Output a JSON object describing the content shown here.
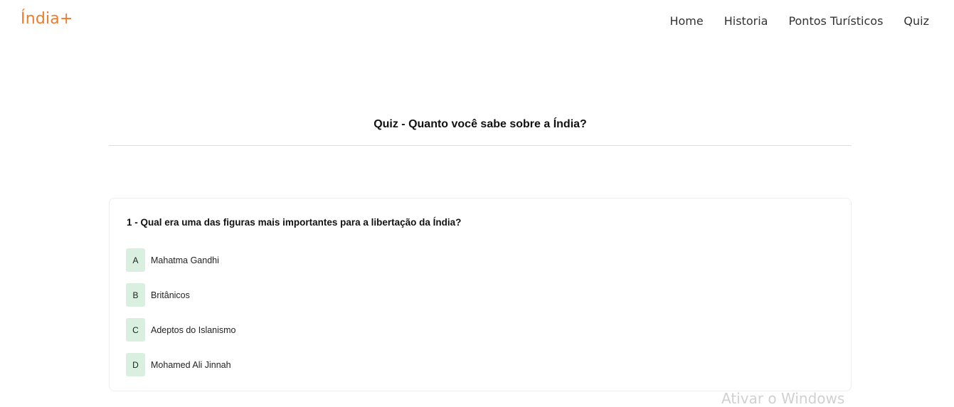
{
  "navbar": {
    "brand": "Índia+",
    "links": [
      "Home",
      "Historia",
      "Pontos Turísticos",
      "Quiz"
    ]
  },
  "quiz": {
    "title": "Quiz - Quanto você sabe sobre a Índia?",
    "question": {
      "text": "1 - Qual era uma das figuras mais importantes para a libertação da Índia?",
      "options": [
        {
          "letter": "A",
          "text": "Mahatma Gandhi"
        },
        {
          "letter": "B",
          "text": "Britânicos"
        },
        {
          "letter": "C",
          "text": "Adeptos do Islanismo"
        },
        {
          "letter": "D",
          "text": "Mohamed Ali Jinnah"
        }
      ]
    }
  },
  "watermark": "Ativar o Windows",
  "colors": {
    "brand": "#f07b2c",
    "option_letter_bg": "#d9efe0",
    "divider": "#dedede"
  }
}
